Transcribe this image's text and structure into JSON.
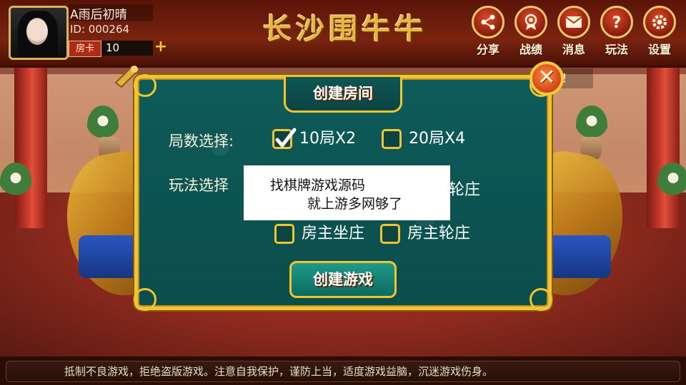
{
  "header": {
    "player_name": "A雨后初晴",
    "player_id": "ID: 000264",
    "room_card_label": "房卡",
    "room_card_value": "10",
    "add_symbol": "+",
    "game_title": "长沙围牛牛",
    "buttons": [
      {
        "label": "分享",
        "icon": "share-icon"
      },
      {
        "label": "战绩",
        "icon": "medal-icon"
      },
      {
        "label": "消息",
        "icon": "mail-icon"
      },
      {
        "label": "玩法",
        "icon": "question-icon"
      },
      {
        "label": "设置",
        "icon": "gear-icon"
      }
    ]
  },
  "marquee": {
    "text": "现！"
  },
  "dialog": {
    "title": "创建房间",
    "close_symbol": "✕",
    "rounds_label": "局数选择:",
    "rounds_options": [
      {
        "label": "10局X2",
        "checked": true
      },
      {
        "label": "20局X4",
        "checked": false
      }
    ],
    "mode_label": "玩法选择",
    "mode_partial_tail": "轮庄",
    "mode_options": [
      {
        "label": "房主坐庄",
        "checked": false
      },
      {
        "label": "房主轮庄",
        "checked": false
      }
    ],
    "create_button": "创建游戏"
  },
  "overlay": {
    "line1": "找棋牌游戏源码",
    "line2": "就上游多网够了"
  },
  "footer": {
    "notice": "抵制不良游戏，拒绝盗版游戏。注意自我保护，谨防上当，适度游戏益脑，沉迷游戏伤身。"
  },
  "colors": {
    "gold": "#f2c530",
    "teal_panel": "#0e5c5a",
    "top_bar": "#7a2410",
    "button_red": "#d94a2a"
  }
}
